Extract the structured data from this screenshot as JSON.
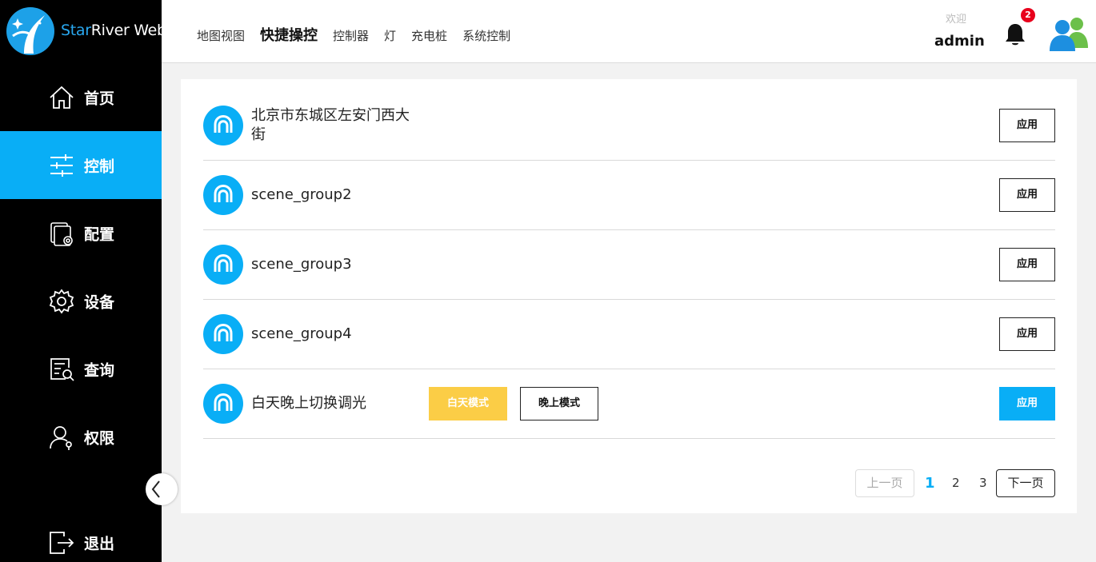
{
  "app": {
    "name_prefix": "Star",
    "name_rest": "River Web"
  },
  "sidebar": {
    "items": [
      {
        "label": "首页",
        "icon": "home-icon"
      },
      {
        "label": "控制",
        "icon": "sliders-icon",
        "active": true
      },
      {
        "label": "配置",
        "icon": "config-icon"
      },
      {
        "label": "设备",
        "icon": "gear-icon"
      },
      {
        "label": "查询",
        "icon": "search-doc-icon"
      },
      {
        "label": "权限",
        "icon": "user-key-icon"
      }
    ],
    "logout": {
      "label": "退出",
      "icon": "logout-icon"
    }
  },
  "header": {
    "nav": [
      "地图视图",
      "快捷操控",
      "控制器",
      "灯",
      "充电桩",
      "系统控制"
    ],
    "active_nav": "快捷操控",
    "welcome": "欢迎",
    "user": "admin",
    "notifications": "2"
  },
  "scenes": [
    {
      "name": "北京市东城区左安门西大街",
      "apply": "应用"
    },
    {
      "name": "scene_group2",
      "apply": "应用"
    },
    {
      "name": "scene_group3",
      "apply": "应用"
    },
    {
      "name": "scene_group4",
      "apply": "应用"
    },
    {
      "name": "白天晚上切换调光",
      "apply": "应用",
      "day_mode": "白天模式",
      "night_mode": "晚上模式"
    }
  ],
  "pagination": {
    "prev": "上一页",
    "pages": [
      "1",
      "2",
      "3"
    ],
    "current": "1",
    "next": "下一页"
  },
  "colors": {
    "accent": "#09aef6",
    "day_mode": "#fbcd46",
    "sidebar": "#000000",
    "badge": "#e8001c"
  }
}
